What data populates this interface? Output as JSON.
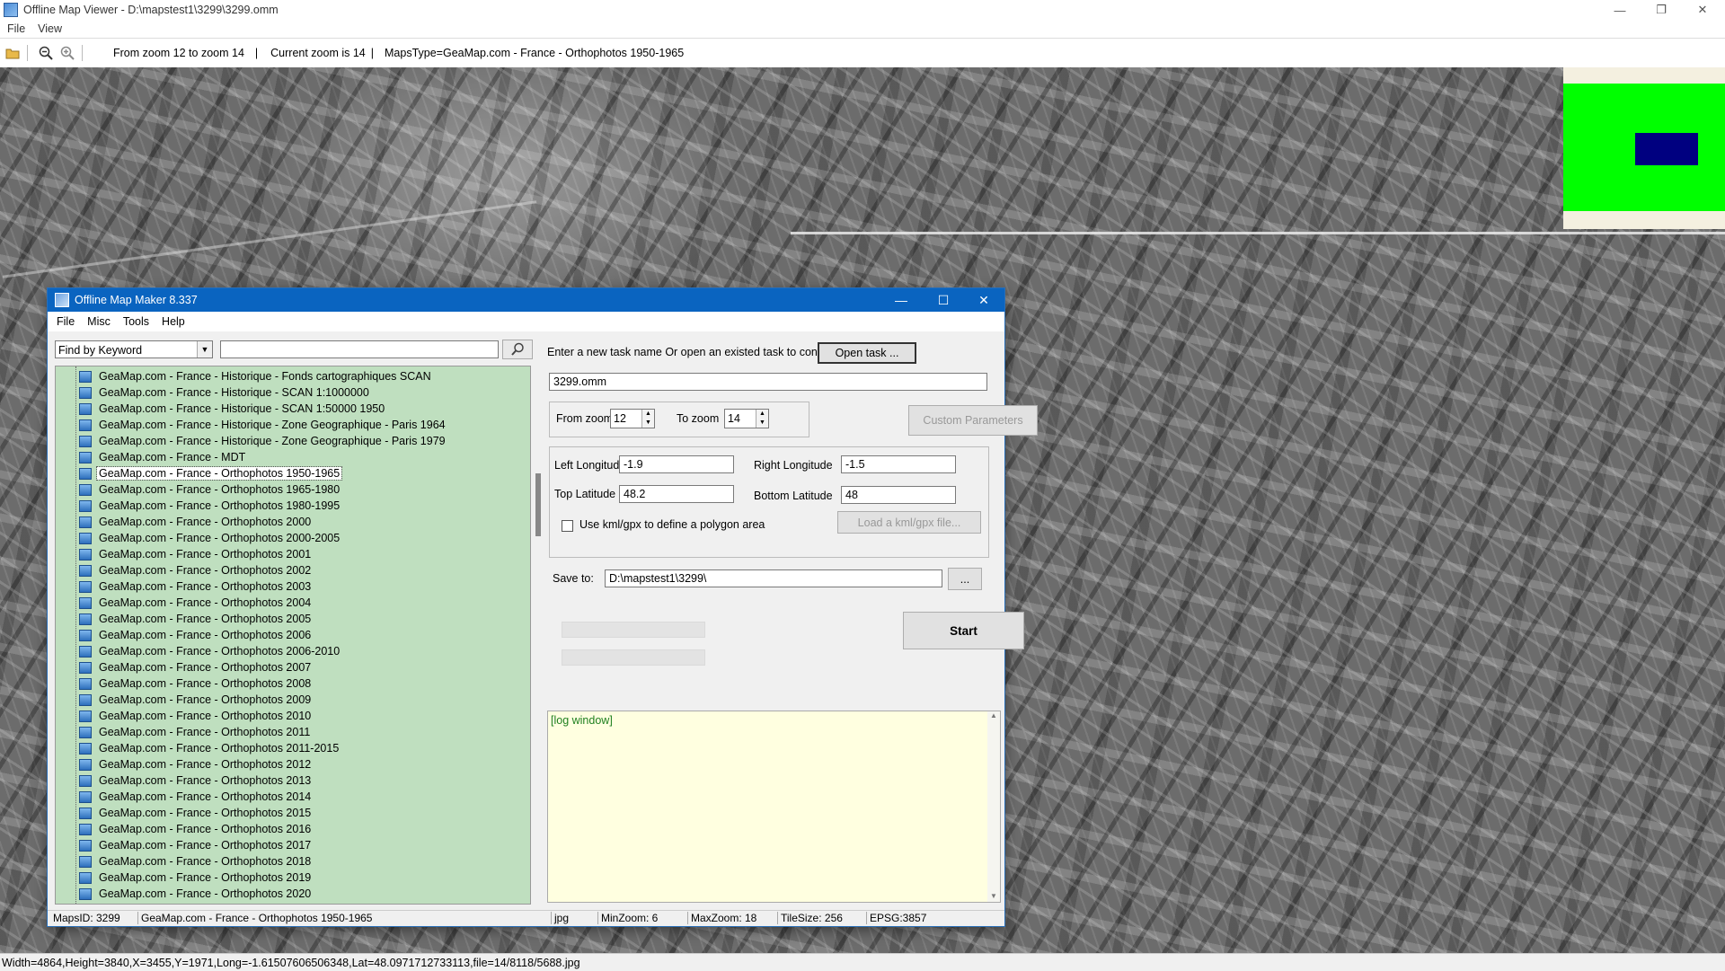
{
  "viewer": {
    "title": "Offline Map Viewer - D:\\mapstest1\\3299\\3299.omm",
    "menu": [
      "File",
      "View"
    ],
    "toolbar": {
      "zoom_range_text": "From zoom 12 to zoom 14",
      "current_zoom_text": "Current zoom is 14",
      "maps_type_text": "MapsType=GeaMap.com - France - Orthophotos 1950-1965"
    },
    "status": "Width=4864,Height=3840,X=3455,Y=1971,Long=-1.61507606506348,Lat=48.0971712733113,file=14/8118/5688.jpg",
    "minimap_colors": {
      "background": "#00ff00",
      "viewport": "#000080"
    }
  },
  "dialog": {
    "title": "Offline Map Maker 8.337",
    "menu": [
      "File",
      "Misc",
      "Tools",
      "Help"
    ],
    "search": {
      "mode": "Find by Keyword",
      "keyword": ""
    },
    "tree_items": [
      "GeaMap.com - France - Historique - Fonds cartographiques SCAN",
      "GeaMap.com - France - Historique - SCAN 1:1000000",
      "GeaMap.com - France - Historique - SCAN 1:50000 1950",
      "GeaMap.com - France - Historique - Zone Geographique - Paris 1964",
      "GeaMap.com - France - Historique - Zone Geographique - Paris 1979",
      "GeaMap.com - France - MDT",
      "GeaMap.com - France - Orthophotos 1950-1965",
      "GeaMap.com - France - Orthophotos 1965-1980",
      "GeaMap.com - France - Orthophotos 1980-1995",
      "GeaMap.com - France - Orthophotos 2000",
      "GeaMap.com - France - Orthophotos 2000-2005",
      "GeaMap.com - France - Orthophotos 2001",
      "GeaMap.com - France - Orthophotos 2002",
      "GeaMap.com - France - Orthophotos 2003",
      "GeaMap.com - France - Orthophotos 2004",
      "GeaMap.com - France - Orthophotos 2005",
      "GeaMap.com - France - Orthophotos 2006",
      "GeaMap.com - France - Orthophotos 2006-2010",
      "GeaMap.com - France - Orthophotos 2007",
      "GeaMap.com - France - Orthophotos 2008",
      "GeaMap.com - France - Orthophotos 2009",
      "GeaMap.com - France - Orthophotos 2010",
      "GeaMap.com - France - Orthophotos 2011",
      "GeaMap.com - France - Orthophotos 2011-2015",
      "GeaMap.com - France - Orthophotos 2012",
      "GeaMap.com - France - Orthophotos 2013",
      "GeaMap.com - France - Orthophotos 2014",
      "GeaMap.com - France - Orthophotos 2015",
      "GeaMap.com - France - Orthophotos 2016",
      "GeaMap.com - France - Orthophotos 2017",
      "GeaMap.com - France - Orthophotos 2018",
      "GeaMap.com - France - Orthophotos 2019",
      "GeaMap.com - France - Orthophotos 2020"
    ],
    "selected_item": "GeaMap.com - France - Orthophotos 1950-1965",
    "task": {
      "prompt": "Enter a new task name Or open an existed task to continue:",
      "open_button": "Open task ...",
      "name": "3299.omm"
    },
    "zoom": {
      "from_label": "From zoom",
      "from_value": "12",
      "to_label": "To zoom",
      "to_value": "14",
      "custom_button": "Custom Parameters"
    },
    "bounds": {
      "left_lon_label": "Left Longitude",
      "left_lon": "-1.9",
      "right_lon_label": "Right Longitude",
      "right_lon": "-1.5",
      "top_lat_label": "Top Latitude",
      "top_lat": "48.2",
      "bottom_lat_label": "Bottom Latitude",
      "bottom_lat": "48",
      "kml_label": "Use kml/gpx to define a polygon area",
      "kml_checked": false,
      "kml_button": "Load a kml/gpx file..."
    },
    "save": {
      "label": "Save to:",
      "path": "D:\\mapstest1\\3299\\",
      "browse_button": "..."
    },
    "start_button": "Start",
    "progress": [
      0,
      0
    ],
    "log_text": "[log window]",
    "status": {
      "maps_id": "MapsID: 3299",
      "name": "GeaMap.com - France - Orthophotos 1950-1965",
      "format": "jpg",
      "min_zoom": "MinZoom: 6",
      "max_zoom": "MaxZoom: 18",
      "tile_size": "TileSize: 256",
      "epsg": "EPSG:3857"
    },
    "colors": {
      "titlebar": "#0a64c0",
      "tree_bg": "#bfdfbf",
      "log_bg": "#ffffe0",
      "log_text": "#208020"
    }
  }
}
